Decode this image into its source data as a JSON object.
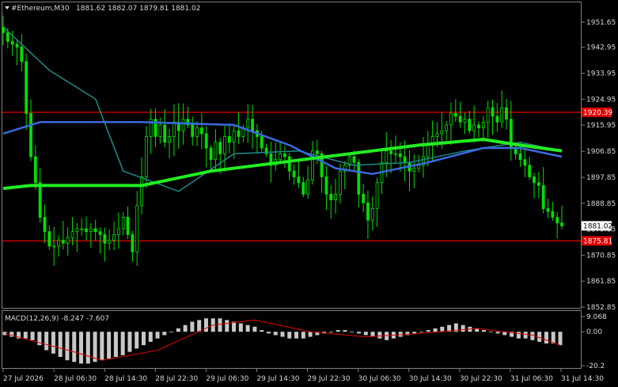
{
  "header": {
    "symbol_label": "#Ethereum,M30",
    "ohlc": "1881.62 1882.07 1879.81 1881.02"
  },
  "macd_header": "MACD(12,26,9) -8.247 -7.607",
  "colors": {
    "background": "#000000",
    "candles": "#00e000",
    "ma_fast": "#3a6ae0",
    "ma_slow": "#22ee22",
    "ma_mid": "#1e8a8a",
    "level_lines": "#e00000",
    "macd_hist": "#c8c8c8",
    "macd_signal": "#e00000",
    "grid_axis": "#808080"
  },
  "chart_data": [
    {
      "type": "candlestick",
      "title": "#Ethereum,M30",
      "y_ticks": [
        "1951.65",
        "1942.95",
        "1933.95",
        "1924.95",
        "1915.95",
        "1906.85",
        "1897.85",
        "1888.85",
        "1879.85",
        "1870.85",
        "1861.85",
        "1852.85"
      ],
      "ylim": [
        1852.85,
        1951.65
      ],
      "x_tick_labels": [
        "27 Jul 2026",
        "28 Jul 06:30",
        "28 Jul 14:30",
        "28 Jul 22:30",
        "29 Jul 06:30",
        "29 Jul 14:30",
        "29 Jul 22:30",
        "30 Jul 06:30",
        "30 Jul 14:30",
        "30 Jul 22:30",
        "31 Jul 06:30",
        "31 Jul 14:30"
      ],
      "horizontal_levels": [
        {
          "label": "1920.39",
          "value": 1920.39
        },
        {
          "label": "1875.81",
          "value": 1875.81
        }
      ],
      "current_price": {
        "label": "1881.02",
        "value": 1881.02
      },
      "close_path": [
        [
          0,
          1948
        ],
        [
          1,
          1945
        ],
        [
          2,
          1944
        ],
        [
          3,
          1943
        ],
        [
          4,
          1938
        ],
        [
          5,
          1920
        ],
        [
          6,
          1905
        ],
        [
          7,
          1896
        ],
        [
          8,
          1884
        ],
        [
          9,
          1879
        ],
        [
          10,
          1874
        ],
        [
          11,
          1874
        ],
        [
          12,
          1876
        ],
        [
          13,
          1875
        ],
        [
          14,
          1877
        ],
        [
          15,
          1879
        ],
        [
          16,
          1880
        ],
        [
          17,
          1880
        ],
        [
          18,
          1879
        ],
        [
          19,
          1880
        ],
        [
          20,
          1879
        ],
        [
          21,
          1878
        ],
        [
          22,
          1875
        ],
        [
          23,
          1876
        ],
        [
          24,
          1878
        ],
        [
          25,
          1880
        ],
        [
          26,
          1884
        ],
        [
          27,
          1878
        ],
        [
          28,
          1872
        ],
        [
          29,
          1888
        ],
        [
          30,
          1898
        ],
        [
          31,
          1912
        ],
        [
          32,
          1918
        ],
        [
          33,
          1912
        ],
        [
          34,
          1916
        ],
        [
          35,
          1910
        ],
        [
          36,
          1912
        ],
        [
          37,
          1917
        ],
        [
          38,
          1914
        ],
        [
          39,
          1918
        ],
        [
          40,
          1916
        ],
        [
          41,
          1912
        ],
        [
          42,
          1915
        ],
        [
          43,
          1913
        ],
        [
          44,
          1908
        ],
        [
          45,
          1904
        ],
        [
          46,
          1910
        ],
        [
          47,
          1906
        ],
        [
          48,
          1912
        ],
        [
          49,
          1910
        ],
        [
          50,
          1914
        ],
        [
          51,
          1912
        ],
        [
          52,
          1915
        ],
        [
          53,
          1918
        ],
        [
          54,
          1914
        ],
        [
          55,
          1912
        ],
        [
          56,
          1908
        ],
        [
          57,
          1906
        ],
        [
          58,
          1902
        ],
        [
          59,
          1904
        ],
        [
          60,
          1906
        ],
        [
          61,
          1905
        ],
        [
          62,
          1900
        ],
        [
          63,
          1898
        ],
        [
          64,
          1896
        ],
        [
          65,
          1892
        ],
        [
          66,
          1897
        ],
        [
          67,
          1907
        ],
        [
          68,
          1906
        ],
        [
          69,
          1898
        ],
        [
          70,
          1892
        ],
        [
          71,
          1890
        ],
        [
          72,
          1892
        ],
        [
          73,
          1900
        ],
        [
          74,
          1902
        ],
        [
          75,
          1905
        ],
        [
          76,
          1903
        ],
        [
          77,
          1892
        ],
        [
          78,
          1889
        ],
        [
          79,
          1883
        ],
        [
          80,
          1887
        ],
        [
          81,
          1896
        ],
        [
          82,
          1903
        ],
        [
          83,
          1907
        ],
        [
          84,
          1906
        ],
        [
          85,
          1906
        ],
        [
          86,
          1905
        ],
        [
          87,
          1903
        ],
        [
          88,
          1900
        ],
        [
          89,
          1901
        ],
        [
          90,
          1902
        ],
        [
          91,
          1905
        ],
        [
          92,
          1909
        ],
        [
          93,
          1912
        ],
        [
          94,
          1913
        ],
        [
          95,
          1914
        ],
        [
          96,
          1916
        ],
        [
          97,
          1920
        ],
        [
          98,
          1919
        ],
        [
          99,
          1917
        ],
        [
          100,
          1918
        ],
        [
          101,
          1914
        ],
        [
          102,
          1916
        ],
        [
          103,
          1915
        ],
        [
          104,
          1917
        ],
        [
          105,
          1922
        ],
        [
          106,
          1919
        ],
        [
          107,
          1917
        ],
        [
          108,
          1922
        ],
        [
          109,
          1918
        ],
        [
          110,
          1908
        ],
        [
          111,
          1906
        ],
        [
          112,
          1904
        ],
        [
          113,
          1902
        ],
        [
          114,
          1898
        ],
        [
          115,
          1896
        ],
        [
          116,
          1895
        ],
        [
          117,
          1887
        ],
        [
          118,
          1886
        ],
        [
          119,
          1884
        ],
        [
          120,
          1882
        ],
        [
          121,
          1881
        ]
      ],
      "ma_fast": [
        [
          0,
          1913
        ],
        [
          8,
          1917
        ],
        [
          30,
          1917
        ],
        [
          50,
          1916
        ],
        [
          62,
          1909
        ],
        [
          72,
          1901
        ],
        [
          80,
          1899
        ],
        [
          92,
          1903
        ],
        [
          104,
          1908
        ],
        [
          112,
          1908
        ],
        [
          121,
          1905
        ]
      ],
      "ma_slow": [
        [
          0,
          1894
        ],
        [
          6,
          1895
        ],
        [
          30,
          1895
        ],
        [
          45,
          1900
        ],
        [
          60,
          1903
        ],
        [
          75,
          1906
        ],
        [
          90,
          1909
        ],
        [
          104,
          1911
        ],
        [
          112,
          1909
        ],
        [
          121,
          1907
        ]
      ],
      "ma_mid": [
        [
          0,
          1950
        ],
        [
          10,
          1935
        ],
        [
          20,
          1925
        ],
        [
          26,
          1900
        ],
        [
          38,
          1893
        ],
        [
          50,
          1906
        ],
        [
          64,
          1907
        ],
        [
          76,
          1902
        ],
        [
          88,
          1903
        ],
        [
          100,
          1907
        ],
        [
          112,
          1910
        ],
        [
          121,
          1907
        ]
      ]
    },
    {
      "type": "macd",
      "title": "MACD(12,26,9) -8.247 -7.607",
      "y_ticks": [
        "9.068",
        "0.00",
        "-20.2"
      ],
      "ylim": [
        -20.2,
        9.068
      ],
      "histogram": [
        -2,
        -3,
        -4,
        -4,
        -5,
        -8,
        -11,
        -13,
        -15,
        -17,
        -18,
        -19,
        -19,
        -18,
        -17,
        -16,
        -15,
        -14,
        -12,
        -10,
        -8,
        -6,
        -4,
        -2,
        0,
        2,
        4,
        6,
        7,
        8,
        8,
        8,
        7,
        6,
        5,
        4,
        3,
        1,
        -1,
        -2,
        -3,
        -4,
        -4,
        -4,
        -3,
        -2,
        -1,
        0,
        1,
        1,
        0,
        -1,
        -2,
        -3,
        -4,
        -5,
        -4,
        -3,
        -2,
        -1,
        0,
        1,
        2,
        3,
        4,
        5,
        4,
        3,
        2,
        1,
        0,
        -1,
        -2,
        -3,
        -4,
        -4,
        -5,
        -6,
        -7,
        -7,
        -8
      ],
      "signal": [
        [
          0,
          -1
        ],
        [
          10,
          -12
        ],
        [
          14,
          -17
        ],
        [
          22,
          -11
        ],
        [
          30,
          4
        ],
        [
          36,
          7
        ],
        [
          44,
          0
        ],
        [
          52,
          -3
        ],
        [
          60,
          -1
        ],
        [
          68,
          2
        ],
        [
          76,
          -2
        ],
        [
          80,
          -8
        ]
      ]
    }
  ]
}
